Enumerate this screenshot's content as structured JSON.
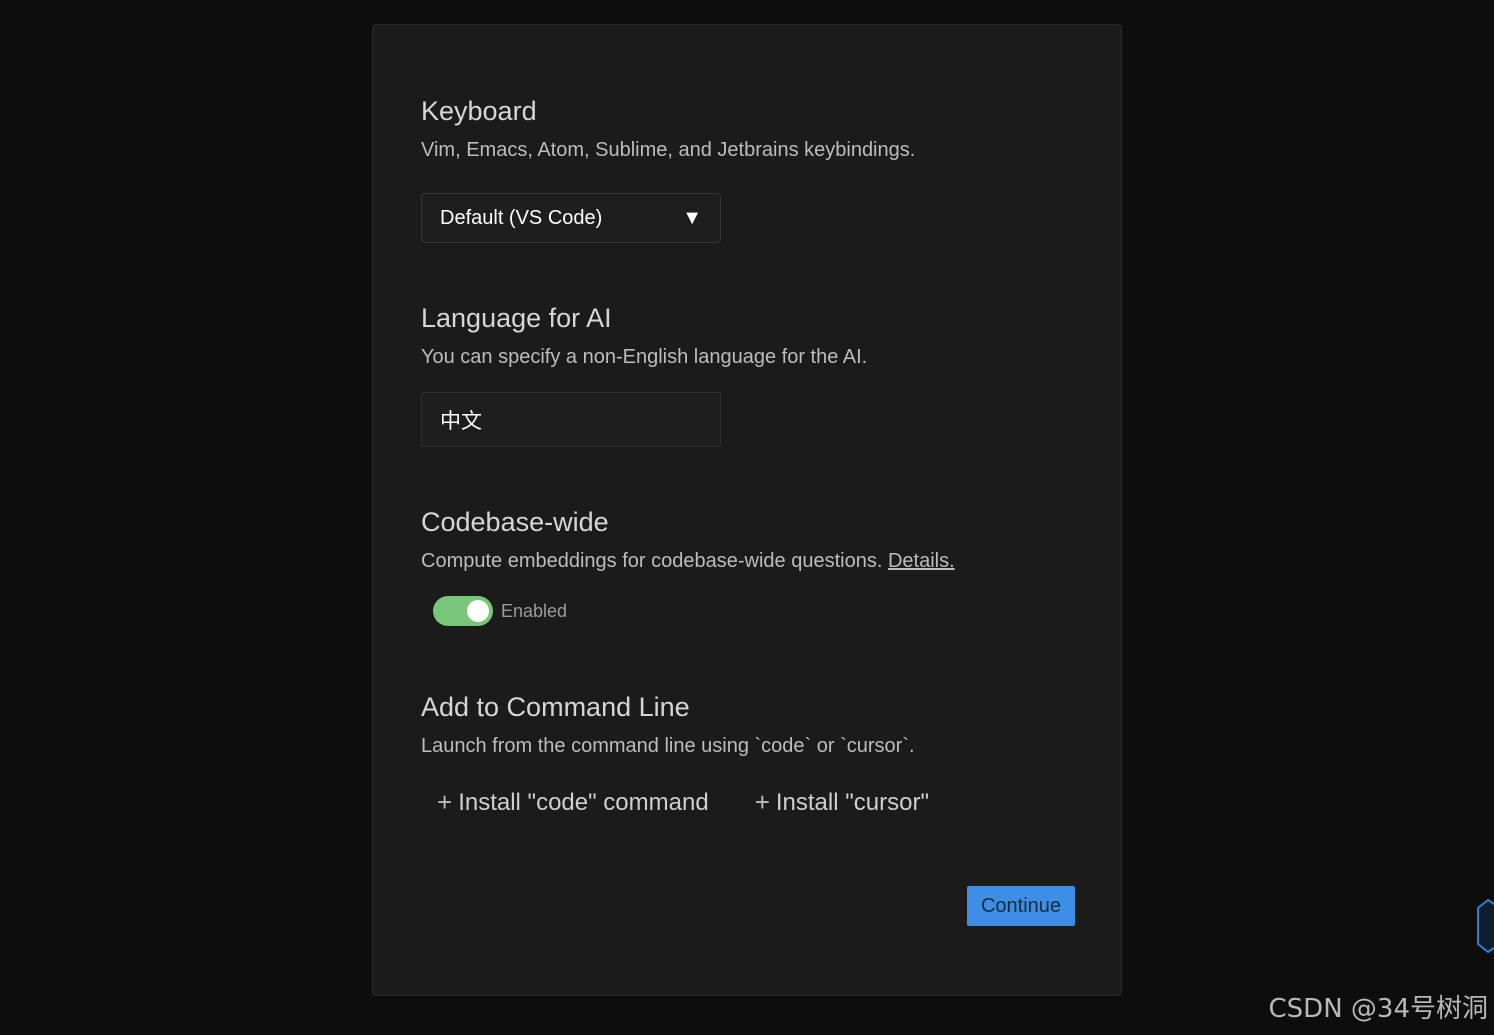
{
  "keyboard": {
    "title": "Keyboard",
    "description": "Vim, Emacs, Atom, Sublime, and Jetbrains keybindings.",
    "selected": "Default (VS Code)",
    "arrow": "▼"
  },
  "language": {
    "title": "Language for AI",
    "description": "You can specify a non-English language for the AI.",
    "value": "中文"
  },
  "codebase": {
    "title": "Codebase-wide",
    "description": "Compute embeddings for codebase-wide questions.",
    "details_link": "Details.",
    "toggle_label": "Enabled",
    "toggle_on": true
  },
  "command_line": {
    "title": "Add to Command Line",
    "description": "Launch from the command line using `code` or `cursor`.",
    "install_code": "Install \"code\" command",
    "install_cursor": "Install \"cursor\"",
    "plus": "+"
  },
  "continue_label": "Continue",
  "watermark": "CSDN @34号树洞",
  "colors": {
    "toggle_on": "#79c67a",
    "continue_bg": "#3c8fe4",
    "panel_bg": "#1b1b1c"
  }
}
